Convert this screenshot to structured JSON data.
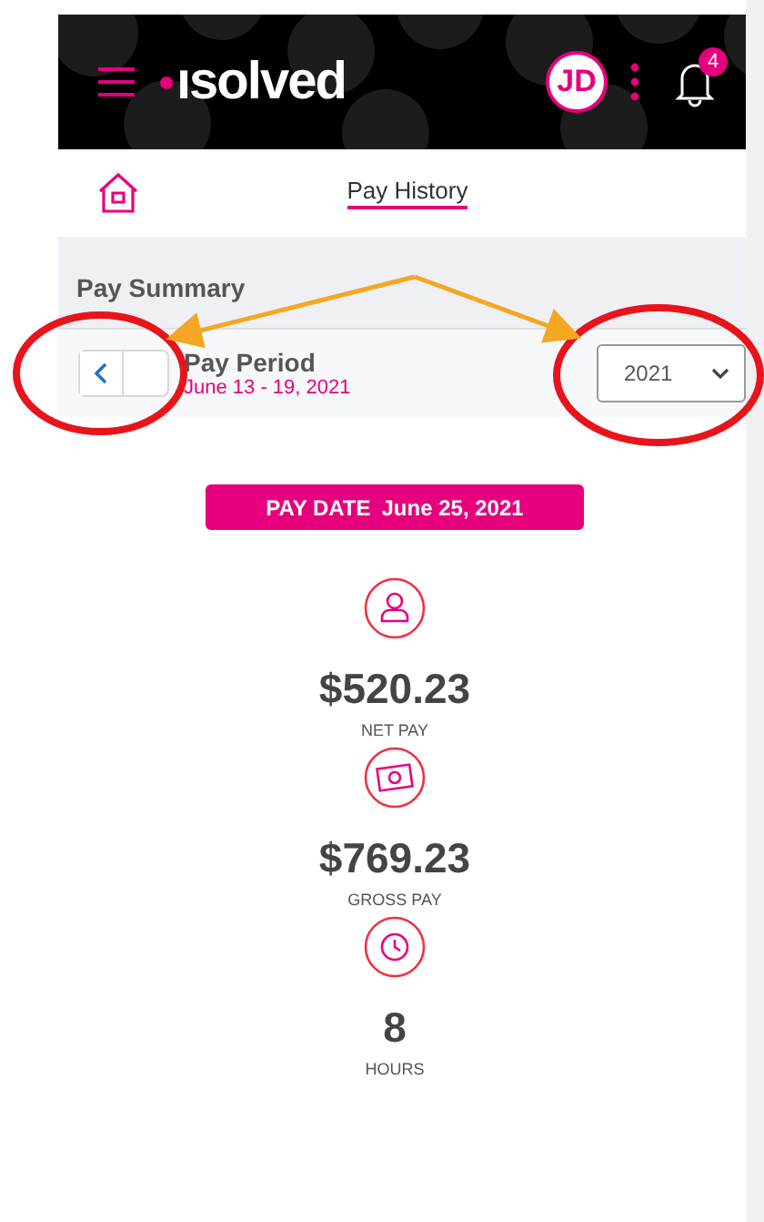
{
  "header": {
    "logo": "ısolved",
    "avatar": "JD",
    "notifications": "4"
  },
  "nav": {
    "title": "Pay History"
  },
  "summary": {
    "title": "Pay Summary",
    "period_label": "Pay Period",
    "period": "June 13 - 19, 2021",
    "year": "2021"
  },
  "pay_date": {
    "label": "PAY DATE",
    "date": "June 25, 2021"
  },
  "metrics": [
    {
      "kind": "person",
      "value": "$520.23",
      "label": "NET PAY"
    },
    {
      "kind": "cash",
      "value": "$769.23",
      "label": "GROSS PAY"
    },
    {
      "kind": "clock",
      "value": "8",
      "label": "HOURS"
    }
  ]
}
